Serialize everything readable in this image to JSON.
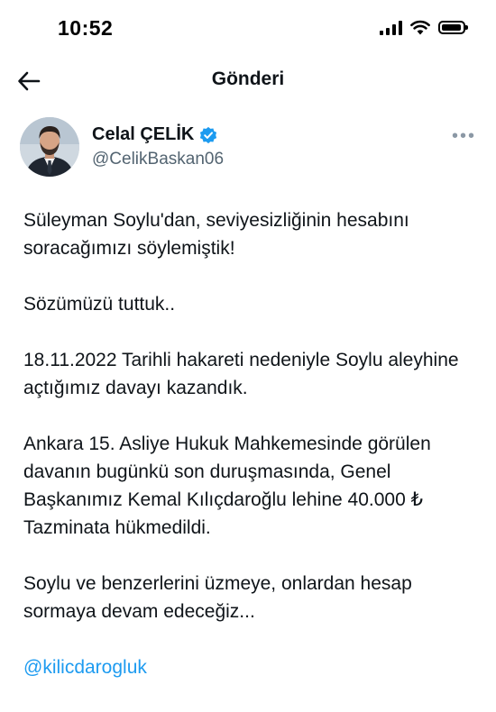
{
  "status_bar": {
    "time": "10:52"
  },
  "header": {
    "title": "Gönderi"
  },
  "author": {
    "name": "Celal ÇELİK",
    "handle": "@CelikBaskan06",
    "verified": true
  },
  "tweet": {
    "paragraphs": [
      "Süleyman Soylu'dan, seviyesizliğinin hesabını soracağımızı söylemiştik!",
      "Sözümüzü tuttuk..",
      "18.11.2022 Tarihli hakareti nedeniyle Soylu aleyhine açtığımız davayı kazandık.",
      "Ankara 15. Asliye Hukuk Mahkemesinde görülen davanın bugünkü son duruşmasında, Genel Başkanımız Kemal Kılıçdaroğlu lehine 40.000 ₺ Tazminata hükmedildi.",
      "Soylu ve benzerlerini üzmeye, onlardan hesap sormaya devam edeceğiz..."
    ],
    "mention": "@kilicdarogluk"
  },
  "colors": {
    "link": "#1d9bf0",
    "verified": "#1d9bf0",
    "text": "#0f1419",
    "secondary": "#536471"
  },
  "icons": {
    "back": "arrow-left-icon",
    "verified": "verified-badge-icon",
    "more": "more-horizontal-icon",
    "signal": "cellular-signal-icon",
    "wifi": "wifi-icon",
    "battery": "battery-icon"
  }
}
